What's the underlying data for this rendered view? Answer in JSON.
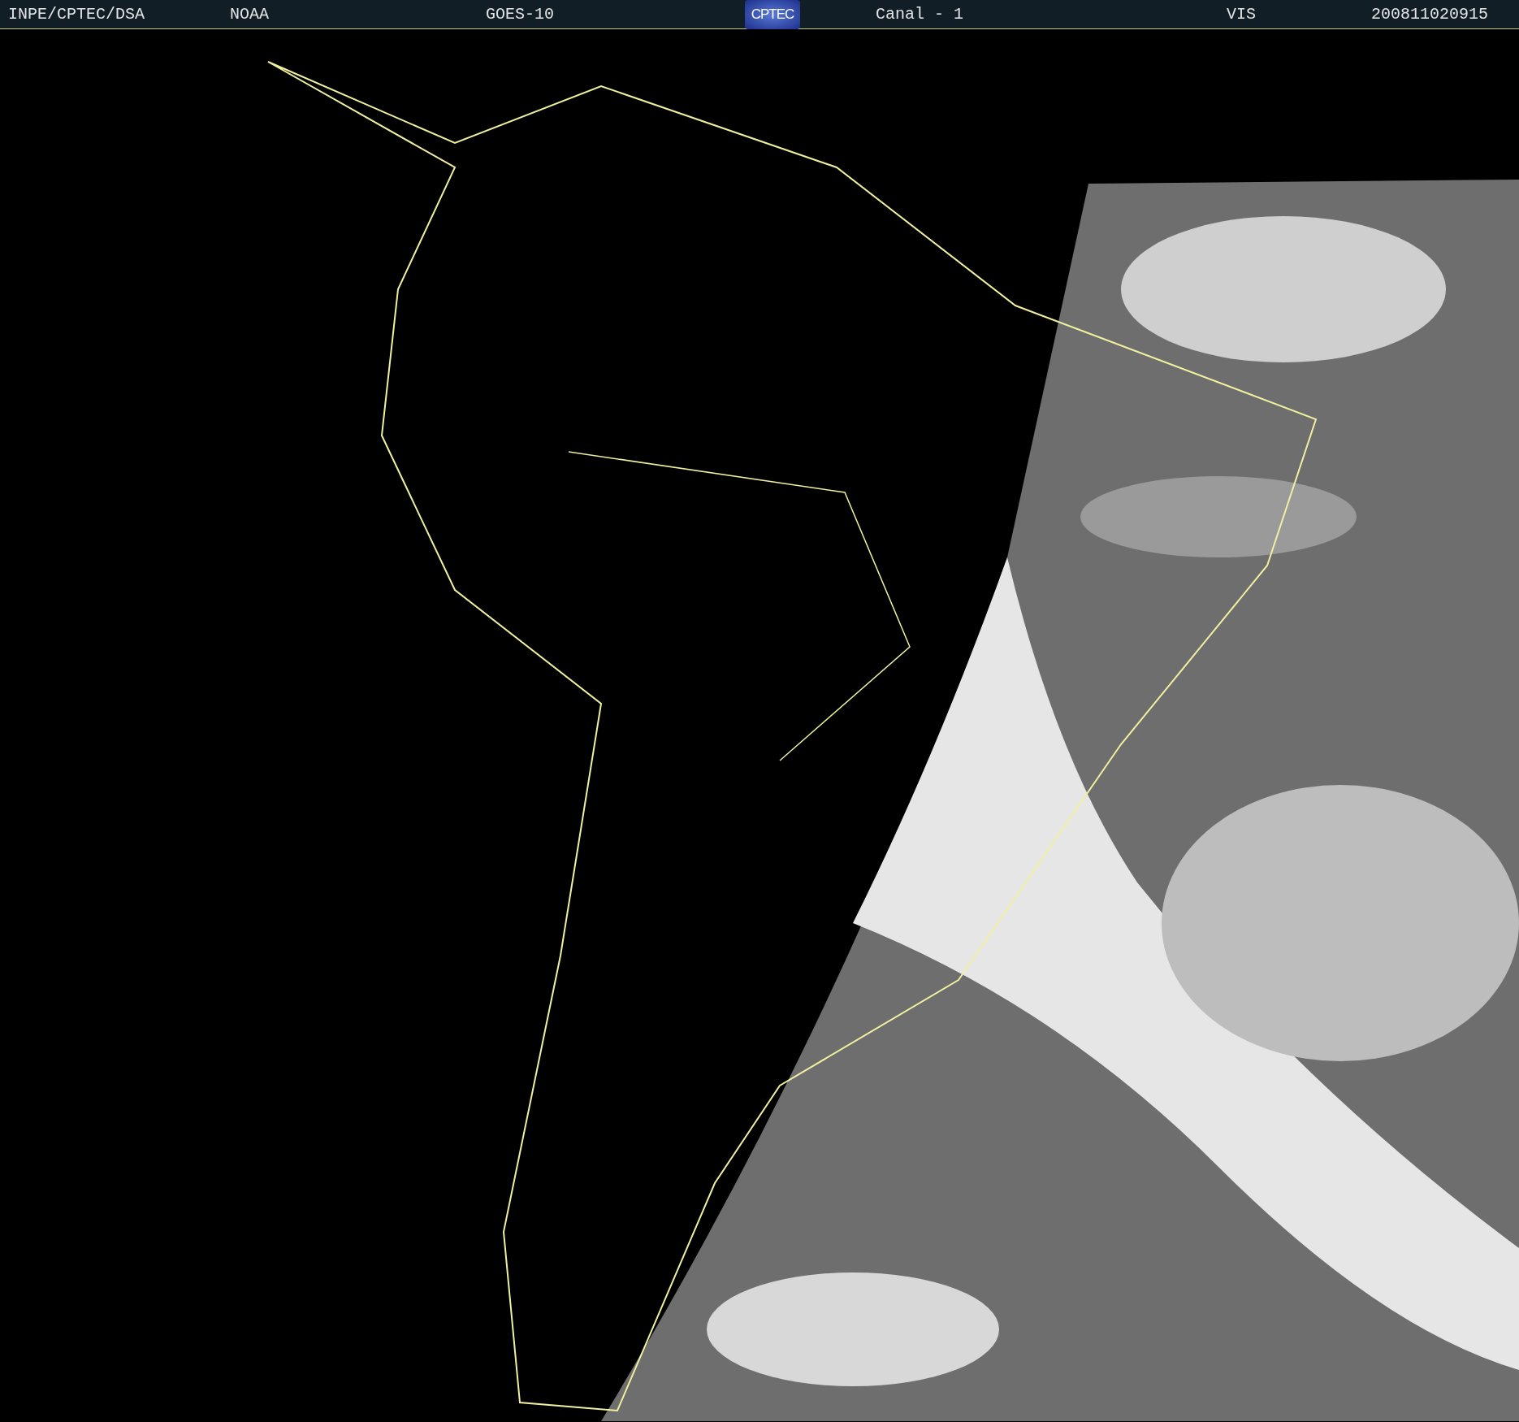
{
  "header": {
    "items": [
      {
        "kind": "text",
        "text": "INPE/CPTEC/DSA"
      },
      {
        "kind": "text",
        "text": "NOAA"
      },
      {
        "kind": "text",
        "text": "GOES-10"
      },
      {
        "kind": "logo",
        "text": "CPTEC"
      },
      {
        "kind": "text",
        "text": "Canal - 1"
      },
      {
        "kind": "text",
        "text": "VIS"
      },
      {
        "kind": "text",
        "text": "200811020915"
      }
    ]
  }
}
